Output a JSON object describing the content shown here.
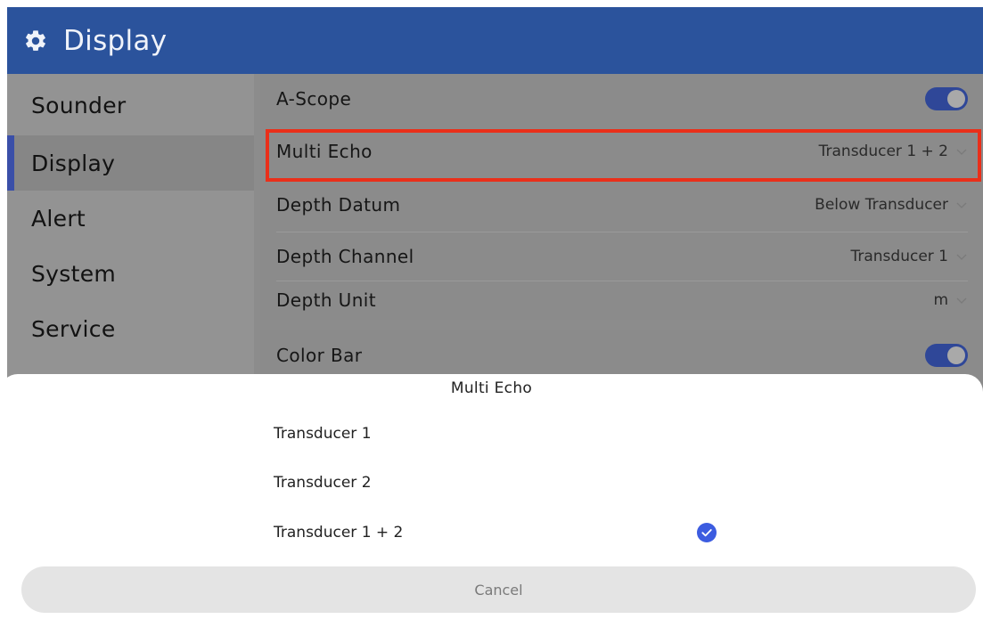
{
  "header": {
    "title": "Display",
    "icon": "gear-icon"
  },
  "sidebar": {
    "items": [
      {
        "label": "Sounder",
        "active": false
      },
      {
        "label": "Display",
        "active": true
      },
      {
        "label": "Alert",
        "active": false
      },
      {
        "label": "System",
        "active": false
      },
      {
        "label": "Service",
        "active": false
      }
    ]
  },
  "settings": {
    "a_scope": {
      "label": "A-Scope",
      "enabled": true
    },
    "multi_echo": {
      "label": "Multi Echo",
      "value": "Transducer 1 + 2"
    },
    "depth_datum": {
      "label": "Depth Datum",
      "value": "Below Transducer"
    },
    "depth_channel": {
      "label": "Depth Channel",
      "value": "Transducer 1"
    },
    "depth_unit": {
      "label": "Depth Unit",
      "value": "m"
    },
    "color_bar": {
      "label": "Color Bar",
      "enabled": true
    }
  },
  "sheet": {
    "title": "Multi Echo",
    "options": [
      {
        "label": "Transducer 1",
        "selected": false
      },
      {
        "label": "Transducer 2",
        "selected": false
      },
      {
        "label": "Transducer 1 + 2",
        "selected": true
      }
    ],
    "cancel_label": "Cancel"
  },
  "colors": {
    "header_bg": "#2b539c",
    "accent": "#2f4798",
    "highlight": "#ea2f1a",
    "check": "#3c5ce0"
  }
}
